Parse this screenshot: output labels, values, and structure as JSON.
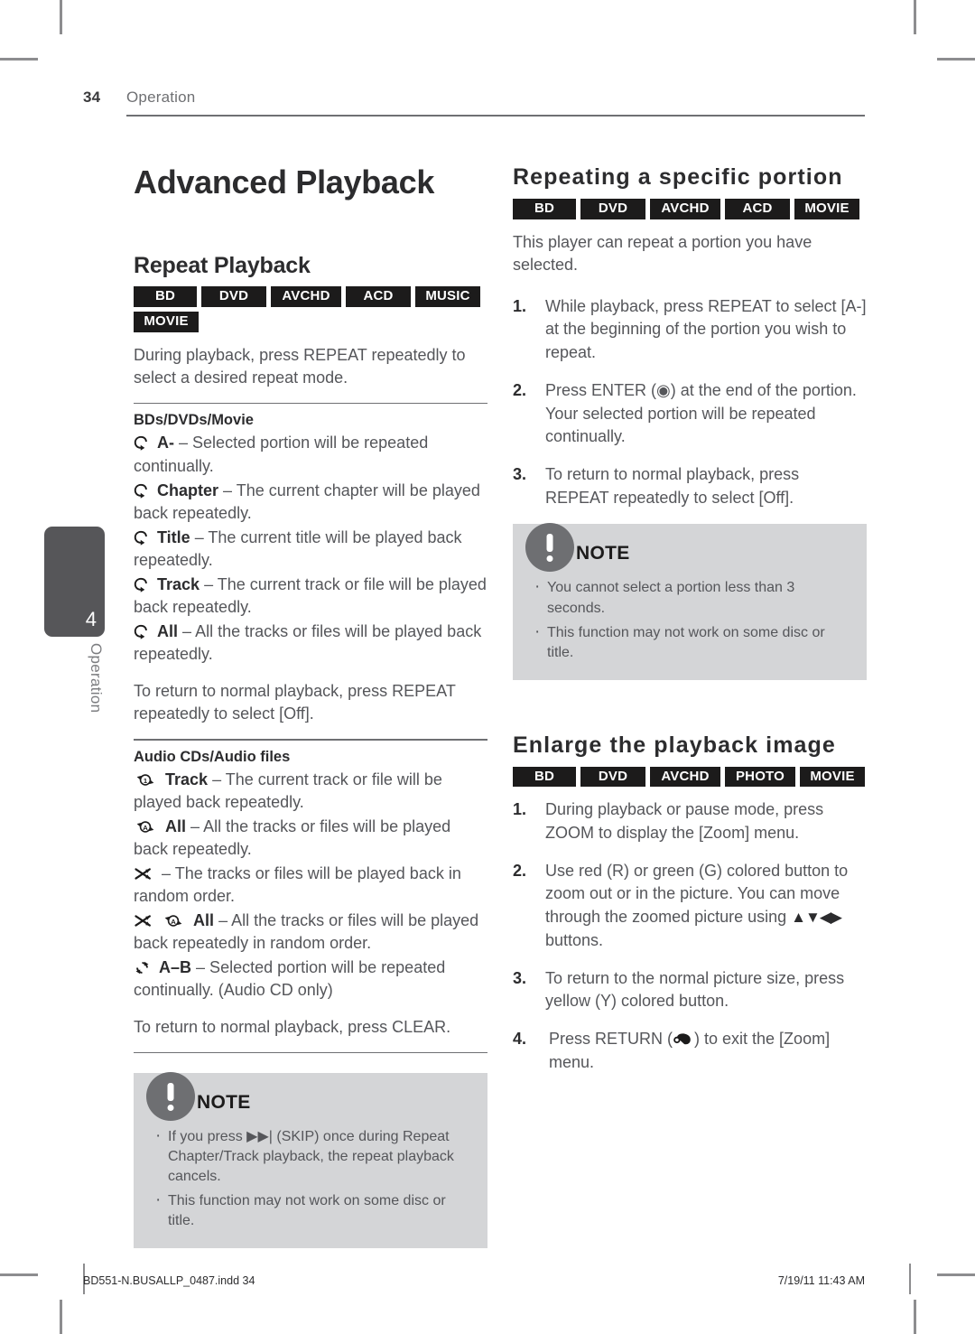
{
  "header": {
    "page_number": "34",
    "chapter": "Operation"
  },
  "side_tab": {
    "number": "4",
    "label": "Operation"
  },
  "left_column": {
    "main_title": "Advanced Playback",
    "repeat_playback": {
      "title": "Repeat Playback",
      "badges": [
        "BD",
        "DVD",
        "AVCHD",
        "ACD",
        "MUSIC",
        "MOVIE"
      ],
      "intro": "During playback, press REPEAT repeatedly to select a desired repeat mode.",
      "bd_group": {
        "heading": "BDs/DVDs/Movie",
        "items": [
          {
            "icon": "repeat-loop-icon",
            "label": "A-",
            "text": "– Selected portion will be repeated continually."
          },
          {
            "icon": "repeat-loop-icon",
            "label": "Chapter",
            "text": "– The current chapter will be played back repeatedly."
          },
          {
            "icon": "repeat-loop-icon",
            "label": "Title",
            "text": "– The current title will be played back repeatedly."
          },
          {
            "icon": "repeat-loop-icon",
            "label": "Track",
            "text": "– The current track or file will be played back repeatedly."
          },
          {
            "icon": "repeat-loop-icon",
            "label": "All",
            "text": "– All the tracks or files will be played back repeatedly."
          }
        ],
        "closing": "To return to normal playback, press REPEAT repeatedly to select [Off]."
      },
      "audio_group": {
        "heading": "Audio CDs/Audio files",
        "items": [
          {
            "icon": "repeat-one-icon",
            "label": "Track",
            "text": "– The current track or file will be played back repeatedly."
          },
          {
            "icon": "repeat-all-icon",
            "label": "All",
            "text": "– All the tracks or files will be played back repeatedly."
          },
          {
            "icon": "shuffle-icon",
            "label": "",
            "text": "– The tracks or files will be played back in random order."
          },
          {
            "icon": "shuffle-repeat-all-icon",
            "label": "All",
            "text": "– All the tracks or files will be played back repeatedly in random order."
          },
          {
            "icon": "repeat-ab-icon",
            "label": "A–B",
            "text": "– Selected portion will be repeated continually. (Audio CD only)"
          }
        ],
        "closing": "To return to normal playback, press CLEAR."
      }
    },
    "note": {
      "title": "NOTE",
      "items": [
        "If you press ▶▶| (SKIP) once during Repeat Chapter/Track playback, the repeat playback cancels.",
        "This function may not work on some disc or title."
      ]
    }
  },
  "right_column": {
    "repeating_portion": {
      "title": "Repeating a specific portion",
      "badges": [
        "BD",
        "DVD",
        "AVCHD",
        "ACD",
        "MOVIE"
      ],
      "intro": "This player can repeat a portion you have selected.",
      "steps": [
        {
          "num": "1.",
          "text": "While playback, press REPEAT to select [A-] at the beginning of the portion you wish to repeat."
        },
        {
          "num": "2.",
          "text": "Press ENTER (◉) at the end of the portion. Your selected portion will be repeated continually."
        },
        {
          "num": "3.",
          "text": "To return to normal playback, press REPEAT repeatedly to select [Off]."
        }
      ]
    },
    "note": {
      "title": "NOTE",
      "items": [
        "You cannot select a portion less than 3 seconds.",
        "This function may not work on some disc or title."
      ]
    },
    "enlarge_image": {
      "title": "Enlarge the playback image",
      "badges": [
        "BD",
        "DVD",
        "AVCHD",
        "PHOTO",
        "MOVIE"
      ],
      "steps": [
        {
          "num": "1.",
          "text": "During playback or pause mode, press ZOOM to display the [Zoom] menu."
        },
        {
          "num": "2.",
          "text_before": "Use red (R) or green (G) colored button to zoom out or in the picture. You can move through the zoomed picture using ",
          "arrows": "▲▼◀▶",
          "text_after": " buttons."
        },
        {
          "num": "3.",
          "text": "To return to the normal picture size, press yellow (Y) colored button."
        },
        {
          "num": "4.",
          "text_before": "Press RETURN (",
          "text_after": ") to exit the [Zoom] menu.",
          "icon": "return-arrow-icon"
        }
      ]
    }
  },
  "footer": {
    "file_name": "BD551-N.BUSALLP_0487.indd   34",
    "timestamp": "7/19/11   11:43 AM"
  },
  "colors": {
    "badge_background": "#1c1b1b",
    "note_background": "#d4d5d7",
    "note_bubble": "#6e6f72",
    "side_tab": "#565659",
    "body_text": "#55565a",
    "heading_text": "#2c2c2e"
  }
}
